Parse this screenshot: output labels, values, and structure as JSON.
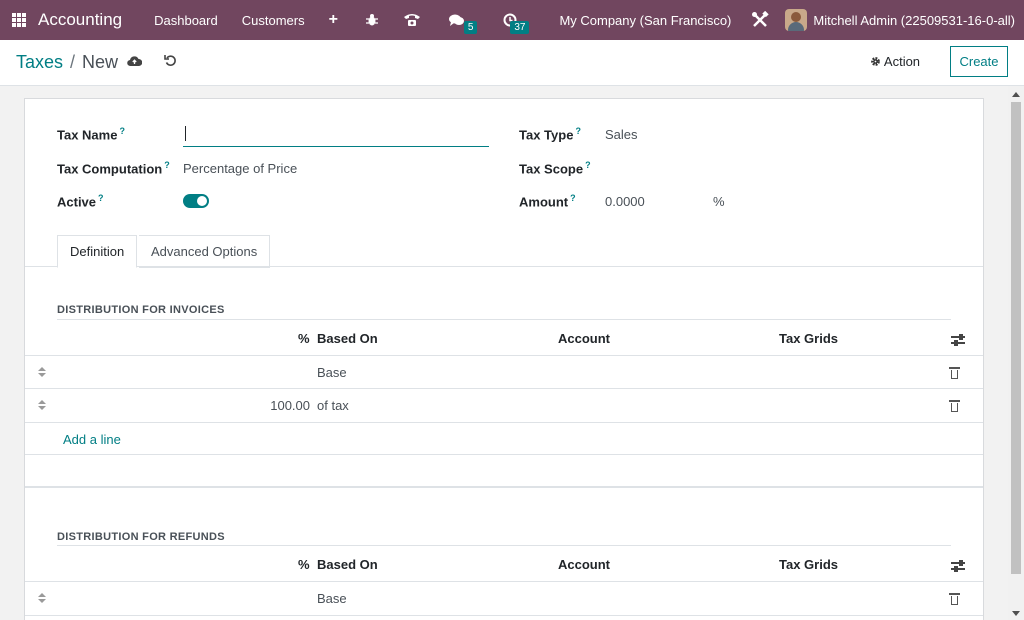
{
  "navbar": {
    "app_name": "Accounting",
    "menu": [
      "Dashboard",
      "Customers"
    ],
    "plus": "+",
    "messages_count": "5",
    "activities_count": "37",
    "company": "My Company (San Francisco)",
    "user": "Mitchell Admin (22509531-16-0-all)"
  },
  "breadcrumb": {
    "parent": "Taxes",
    "separator": "/",
    "current": "New"
  },
  "control": {
    "action_label": "Action",
    "create_label": "Create"
  },
  "form": {
    "tax_name_label": "Tax Name",
    "tax_name_value": "",
    "tax_computation_label": "Tax Computation",
    "tax_computation_value": "Percentage of Price",
    "active_label": "Active",
    "active_value": true,
    "tax_type_label": "Tax Type",
    "tax_type_value": "Sales",
    "tax_scope_label": "Tax Scope",
    "tax_scope_value": "",
    "amount_label": "Amount",
    "amount_value": "0.0000",
    "amount_unit": "%",
    "help_mark": "?"
  },
  "tabs": [
    "Definition",
    "Advanced Options"
  ],
  "invoices": {
    "title": "DISTRIBUTION FOR INVOICES",
    "columns": [
      "%",
      "Based On",
      "Account",
      "Tax Grids"
    ],
    "rows": [
      {
        "percent": "",
        "based_on": "Base",
        "account": "",
        "tax_grids": ""
      },
      {
        "percent": "100.00",
        "based_on": "of tax",
        "account": "",
        "tax_grids": ""
      }
    ],
    "add_line": "Add a line"
  },
  "refunds": {
    "title": "DISTRIBUTION FOR REFUNDS",
    "columns": [
      "%",
      "Based On",
      "Account",
      "Tax Grids"
    ],
    "rows": [
      {
        "percent": "",
        "based_on": "Base",
        "account": "",
        "tax_grids": ""
      }
    ]
  },
  "colors": {
    "navbar": "#71465f",
    "accent": "#017e84",
    "badge": "#017e84"
  }
}
